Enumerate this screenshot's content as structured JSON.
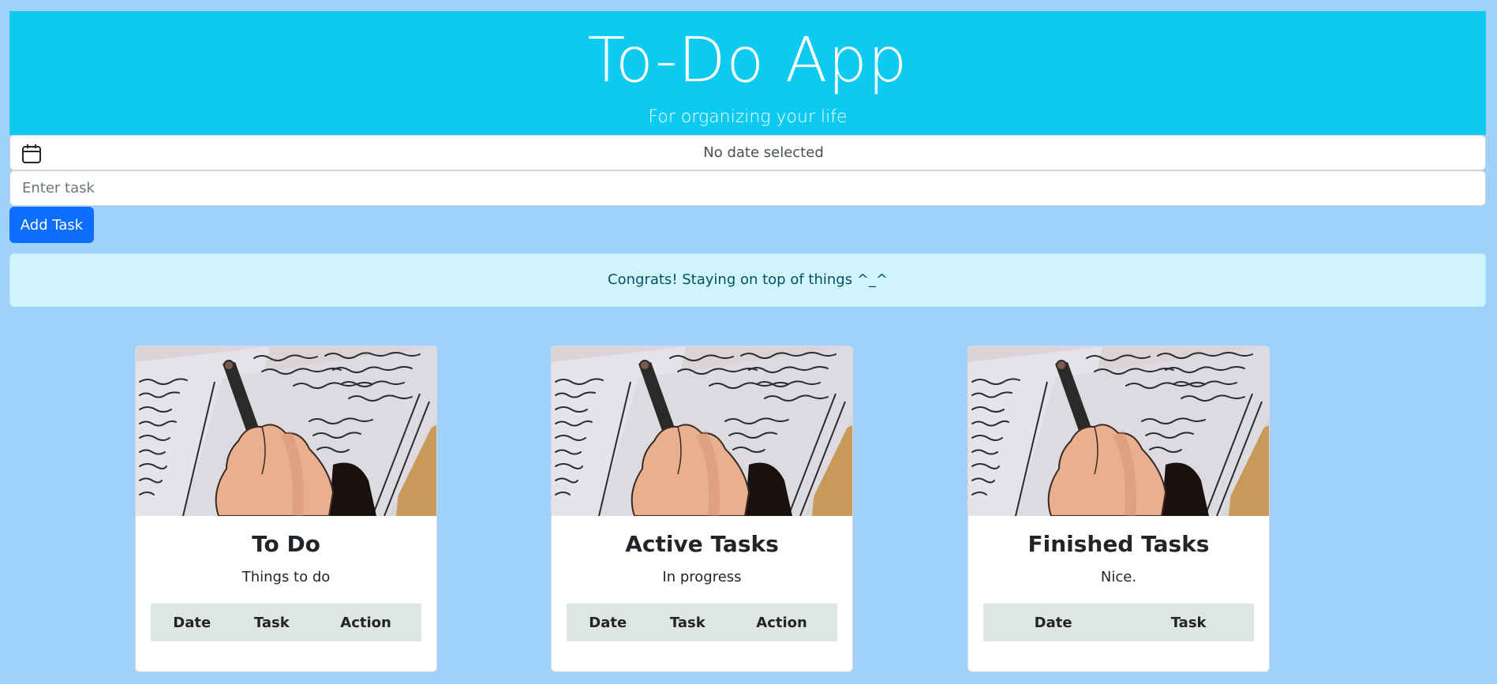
{
  "header": {
    "title": "To-Do App",
    "subtitle": "For organizing your life"
  },
  "date_picker": {
    "icon": "calendar-icon",
    "value": "No date selected"
  },
  "task_input": {
    "placeholder": "Enter task",
    "value": ""
  },
  "add_button": {
    "label": "Add Task"
  },
  "alert": {
    "message": "Congrats! Staying on top of things ^_^"
  },
  "cards": [
    {
      "title": "To Do",
      "subtitle": "Things to do",
      "columns": [
        "Date",
        "Task",
        "Action"
      ]
    },
    {
      "title": "Active Tasks",
      "subtitle": "In progress",
      "columns": [
        "Date",
        "Task",
        "Action"
      ]
    },
    {
      "title": "Finished Tasks",
      "subtitle": "Nice.",
      "columns": [
        "Date",
        "Task"
      ]
    }
  ],
  "colors": {
    "page_background": "#a0d0fc",
    "header_background": "#0dcaf0",
    "button_primary": "#0d6efd",
    "alert_background": "#cff4fc",
    "alert_text": "#055160",
    "table_header": "#dee6e1"
  }
}
